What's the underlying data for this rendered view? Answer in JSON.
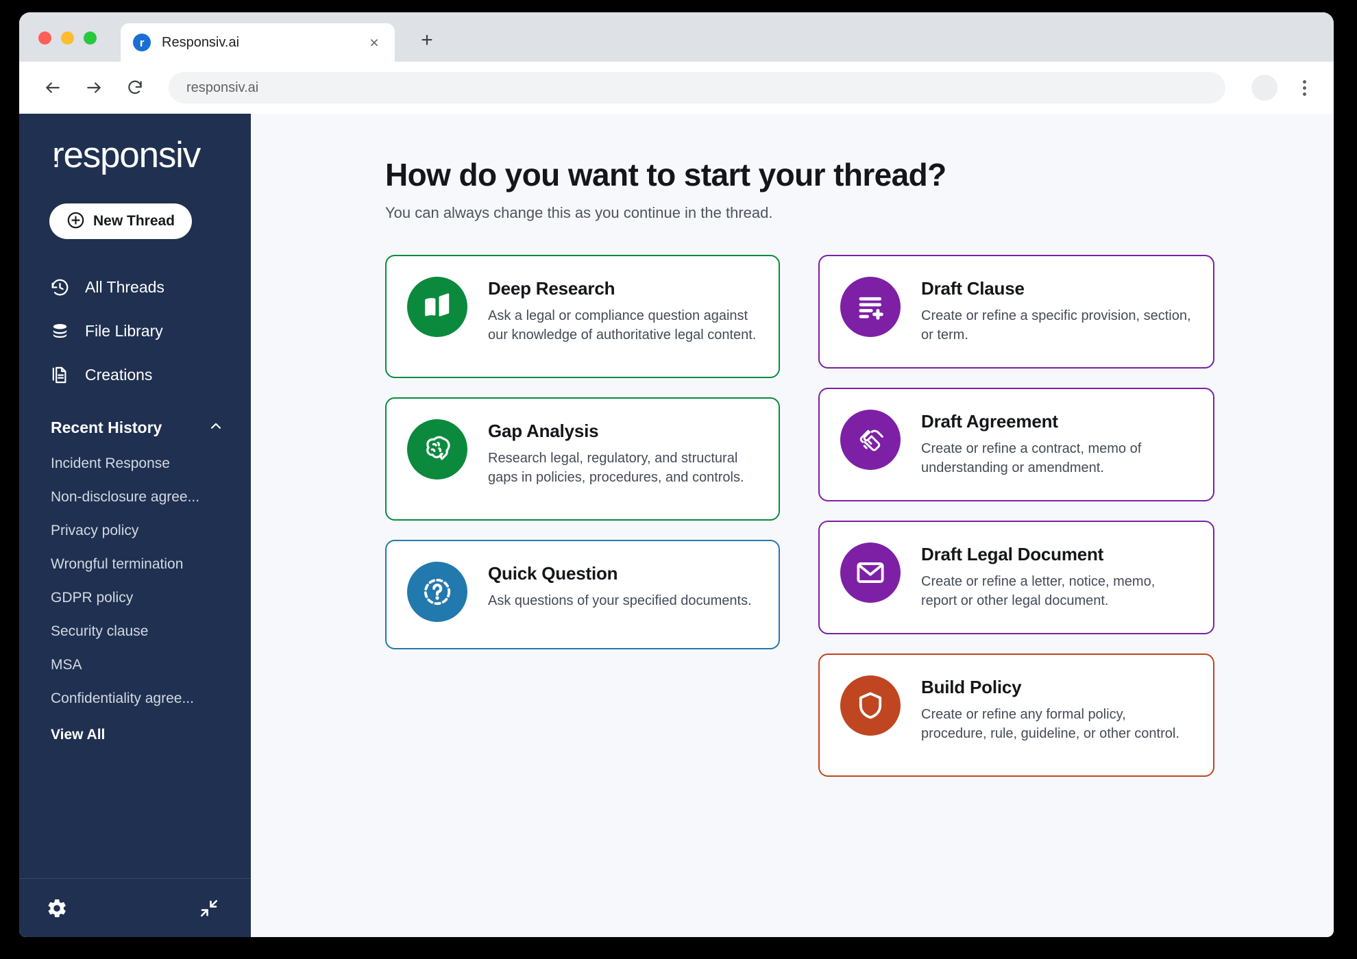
{
  "browser": {
    "tab": {
      "title": "Responsiv.ai",
      "favicon_letter": "r",
      "close_label": "×"
    },
    "new_tab_label": "+",
    "url": "responsiv.ai",
    "back_icon": "back-arrow-icon",
    "forward_icon": "forward-arrow-icon",
    "reload_icon": "reload-icon"
  },
  "sidebar": {
    "logo": {
      "prefix": "r",
      "rest": "esponsiv"
    },
    "new_thread_label": "New Thread",
    "nav": [
      {
        "label": "All Threads",
        "icon": "history-clock-icon"
      },
      {
        "label": "File Library",
        "icon": "database-stack-icon"
      },
      {
        "label": "Creations",
        "icon": "documents-icon"
      }
    ],
    "section": {
      "title": "Recent History",
      "chevron": "chevron-up-icon"
    },
    "history": [
      "Incident Response",
      "Non-disclosure agree...",
      "Privacy policy",
      "Wrongful termination",
      "GDPR policy",
      "Security clause",
      "MSA",
      "Confidentiality agree..."
    ],
    "view_all_label": "View All",
    "footer": {
      "settings_icon": "gear-icon",
      "collapse_icon": "collapse-arrows-icon"
    },
    "bg_color": "#1f3050"
  },
  "main": {
    "title": "How do you want to start your thread?",
    "subtitle": "You can always change this as you continue in the thread.",
    "left_cards": [
      {
        "title": "Deep Research",
        "desc": "Ask a legal or compliance question against our knowledge of authoritative legal content.",
        "icon": "open-book-icon",
        "color": "#0b8a3e"
      },
      {
        "title": "Gap Analysis",
        "desc": "Research legal, regulatory, and structural gaps in policies, procedures, and controls.",
        "icon": "brain-icon",
        "color": "#0b8a3e"
      },
      {
        "title": "Quick Question",
        "desc": "Ask questions of your specified documents.",
        "icon": "question-circle-icon",
        "color": "#2279ae"
      }
    ],
    "right_cards": [
      {
        "title": "Draft Clause",
        "desc": "Create or refine a specific provision, section, or term.",
        "icon": "document-lines-plus-icon",
        "color": "#7d20a5"
      },
      {
        "title": "Draft Agreement",
        "desc": "Create or refine a contract, memo of understanding or amendment.",
        "icon": "handshake-icon",
        "color": "#7d20a5"
      },
      {
        "title": "Draft Legal Document",
        "desc": "Create or refine a letter, notice, memo, report or other legal document.",
        "icon": "envelope-icon",
        "color": "#7d20a5"
      },
      {
        "title": "Build Policy",
        "desc": "Create or refine any formal policy, procedure, rule, guideline, or other control.",
        "icon": "shield-icon",
        "color": "#bf4621"
      }
    ]
  }
}
